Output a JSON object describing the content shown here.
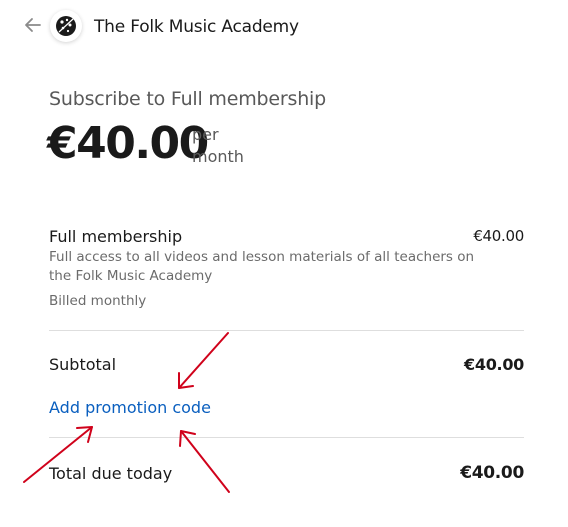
{
  "header": {
    "brand_name": "The Folk Music Academy",
    "back_icon": "back-arrow-icon",
    "logo_icon": "academy-logo-icon"
  },
  "summary": {
    "subtitle": "Subscribe to Full membership",
    "price": "€40.00",
    "period_line1": "per",
    "period_line2": "month"
  },
  "line_item": {
    "name": "Full membership",
    "price": "€40.00",
    "description": "Full access to all videos and lesson materials of all teachers on the Folk Music Academy",
    "billing": "Billed monthly"
  },
  "totals": {
    "subtotal_label": "Subtotal",
    "subtotal_value": "€40.00",
    "promo_link": "Add promotion code",
    "total_label": "Total due today",
    "total_value": "€40.00"
  },
  "colors": {
    "link": "#0a5fbf",
    "annotation_arrow": "#d0021b"
  }
}
